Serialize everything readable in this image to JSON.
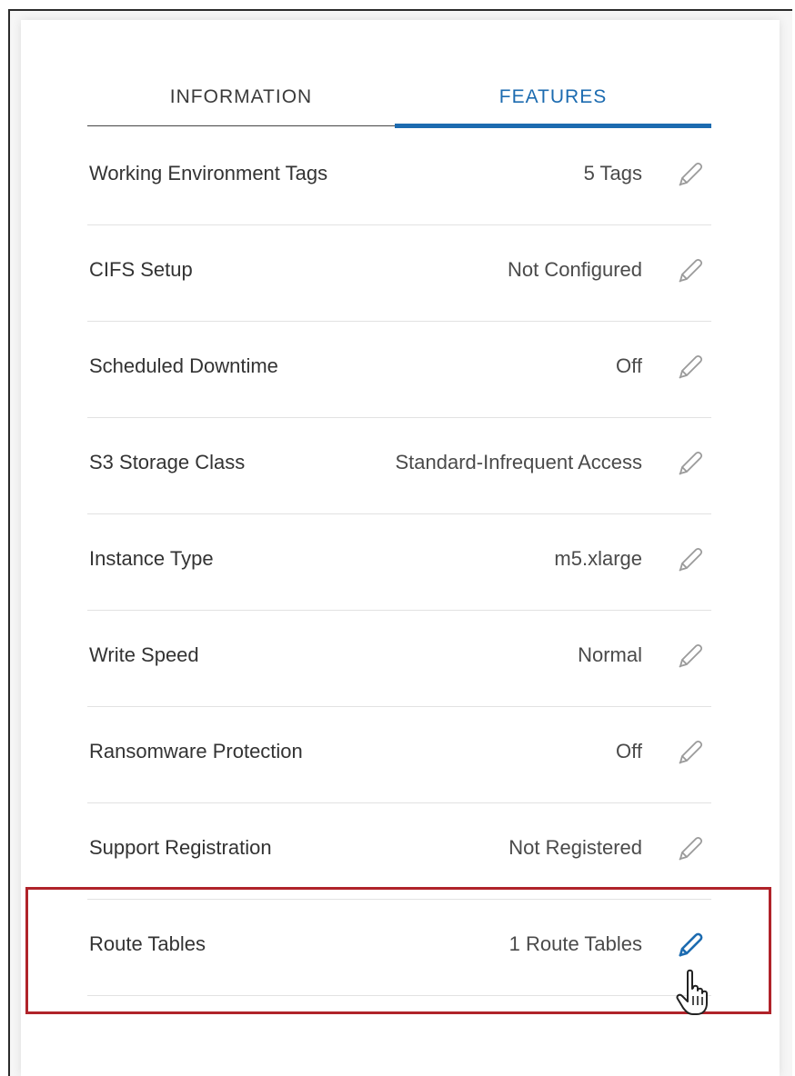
{
  "tabs": {
    "information": "INFORMATION",
    "features": "FEATURES",
    "active": "features"
  },
  "features": [
    {
      "label": "Working Environment Tags",
      "value": "5 Tags"
    },
    {
      "label": "CIFS Setup",
      "value": "Not Configured"
    },
    {
      "label": "Scheduled Downtime",
      "value": "Off"
    },
    {
      "label": "S3 Storage Class",
      "value": "Standard-Infrequent Access"
    },
    {
      "label": "Instance Type",
      "value": "m5.xlarge"
    },
    {
      "label": "Write Speed",
      "value": "Normal"
    },
    {
      "label": "Ransomware Protection",
      "value": "Off"
    },
    {
      "label": "Support Registration",
      "value": "Not Registered"
    },
    {
      "label": "Route Tables",
      "value": "1 Route Tables",
      "highlighted": true
    }
  ],
  "icons": {
    "edit": "pencil-icon",
    "cursor": "hand-pointer-icon"
  },
  "colors": {
    "accent": "#1c6bb0",
    "highlight_border": "#b0232a",
    "edit_icon_idle": "#9a9a9a",
    "edit_icon_hover": "#1c6bb0"
  }
}
